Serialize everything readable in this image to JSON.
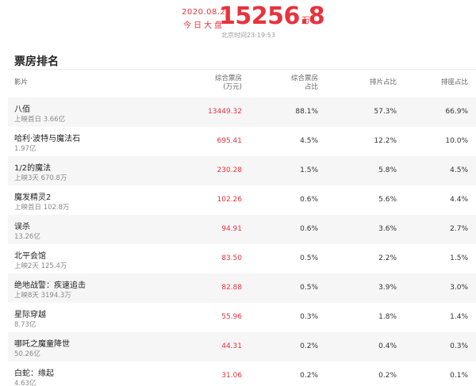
{
  "header": {
    "date": "2020.08.21",
    "label": "今日大盘",
    "value": "15256.8",
    "unit": "万",
    "time": "北京时间23:19:53"
  },
  "section_title": "票房排名",
  "columns": {
    "film": "影片",
    "boxoffice": [
      "综合票房",
      "(万元)"
    ],
    "share": [
      "综合票房",
      "占比"
    ],
    "screening": "排片占比",
    "seat": "排座占比"
  },
  "rows": [
    {
      "title": "八佰",
      "sub": "上映首日 3.66亿",
      "boxoffice": "13449.32",
      "share": "88.1%",
      "screening": "57.3%",
      "seat": "66.9%"
    },
    {
      "title": "哈利·波特与魔法石",
      "sub": "1.97亿",
      "boxoffice": "695.41",
      "share": "4.5%",
      "screening": "12.2%",
      "seat": "10.0%"
    },
    {
      "title": "1/2的魔法",
      "sub": "上映3天 670.8万",
      "boxoffice": "230.28",
      "share": "1.5%",
      "screening": "5.8%",
      "seat": "4.5%"
    },
    {
      "title": "魔发精灵2",
      "sub": "上映首日 102.8万",
      "boxoffice": "102.26",
      "share": "0.6%",
      "screening": "5.6%",
      "seat": "4.4%"
    },
    {
      "title": "误杀",
      "sub": "13.26亿",
      "boxoffice": "94.91",
      "share": "0.6%",
      "screening": "3.6%",
      "seat": "2.7%"
    },
    {
      "title": "北平会馆",
      "sub": "上映2天 125.4万",
      "boxoffice": "83.50",
      "share": "0.5%",
      "screening": "2.2%",
      "seat": "1.5%"
    },
    {
      "title": "绝地战警：疾速追击",
      "sub": "上映8天 3194.3万",
      "boxoffice": "82.88",
      "share": "0.5%",
      "screening": "3.9%",
      "seat": "3.0%"
    },
    {
      "title": "星际穿越",
      "sub": "8.73亿",
      "boxoffice": "55.96",
      "share": "0.3%",
      "screening": "1.8%",
      "seat": "1.4%"
    },
    {
      "title": "哪吒之魔童降世",
      "sub": "50.26亿",
      "boxoffice": "44.31",
      "share": "0.2%",
      "screening": "0.4%",
      "seat": "0.3%"
    },
    {
      "title": "白蛇：缘起",
      "sub": "4.63亿",
      "boxoffice": "31.06",
      "share": "0.2%",
      "screening": "0.2%",
      "seat": "0.1%"
    }
  ],
  "colors": {
    "accent": "#e8323c",
    "row_alt": "#f6f6f7"
  }
}
